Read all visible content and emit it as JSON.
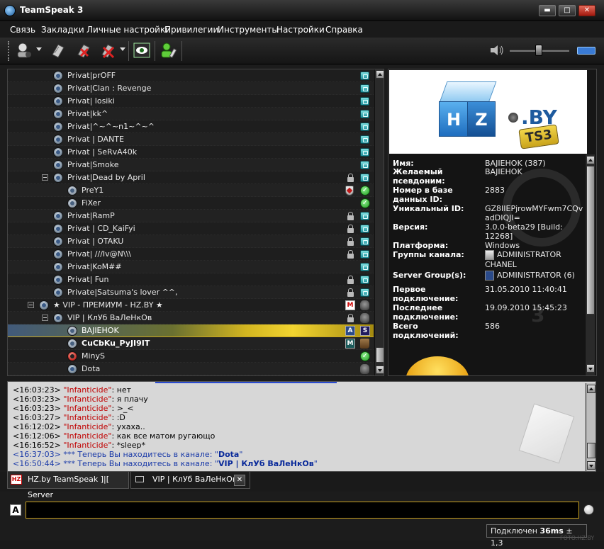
{
  "window": {
    "title": "TeamSpeak 3",
    "minimize": "▬",
    "maximize": "□",
    "close": "✕"
  },
  "menu": [
    "Связь",
    "Закладки",
    "Личные настройки",
    "Привилегии",
    "Инструменты",
    "Настройки",
    "Справка"
  ],
  "toolbar": {
    "icons": [
      "connect-icon",
      "bookmark-icon",
      "disconnect-icon",
      "disconnect-all-icon",
      "away-icon",
      "identity-icon"
    ],
    "volume_icon": "speaker-icon"
  },
  "tree": [
    {
      "label": "Privat|prOFF",
      "chat": true
    },
    {
      "label": "Privat|Clan : Revenge",
      "chat": true
    },
    {
      "label": "Privat| losiki",
      "chat": true
    },
    {
      "label": "Privat|kk^",
      "chat": true
    },
    {
      "label": "Privat|^~^~n1~^~^",
      "chat": true
    },
    {
      "label": "Privat | DANTE",
      "chat": true
    },
    {
      "label": "Privat | SeRvA40k",
      "chat": true
    },
    {
      "label": "Privat|Smoke",
      "chat": true
    },
    {
      "label": "Privat|Dead by April",
      "chat": true,
      "lock": true,
      "expander": true
    },
    {
      "label": "PreY1",
      "user": true,
      "shield": true,
      "ok": true
    },
    {
      "label": "FiXer",
      "user": true,
      "ok": true
    },
    {
      "label": "Privat|RamP",
      "chat": true,
      "lock": true,
      "dash": true
    },
    {
      "label": "Privat | CD_KaiFyi",
      "chat": true,
      "lock": true
    },
    {
      "label": "Privat | OTAKU",
      "chat": true,
      "lock": true
    },
    {
      "label": "Privat| ///Iv@N\\\\\\",
      "chat": true,
      "lock": true
    },
    {
      "label": "Privat|KoM##",
      "chat": true
    },
    {
      "label": "Privat| Fun",
      "chat": true,
      "lock": true
    },
    {
      "label": "Private|Satsuma's lover ^^,",
      "chat": true,
      "lock": true
    },
    {
      "label": "★ VIP - ПРЕМИУМ - HZ.BY ★",
      "lock": true,
      "m": true,
      "wolf": true,
      "expander": true,
      "level": 0
    },
    {
      "label": "VIP | КлУб ВаЛеНкОв",
      "lock": true,
      "dash": true,
      "wolf": true,
      "expander": true,
      "level": 1
    },
    {
      "label": "BAJIEHOK",
      "user": true,
      "selected": true,
      "shield": true,
      "a": true,
      "s": true
    },
    {
      "label": "CuCbKu_PyJI9IT",
      "user": true,
      "bold": true,
      "shield": true,
      "mbadge": true,
      "boot": true
    },
    {
      "label": "MinyS",
      "user": true,
      "red": true,
      "ok": true
    },
    {
      "label": "Dota",
      "wolf": true
    }
  ],
  "info": {
    "banner_cube_left": "H",
    "banner_cube_right": "Z",
    "banner_by": ".BY",
    "banner_ts3": "TS3",
    "watermark": "3",
    "fields": [
      {
        "k": "Имя:",
        "v": "BAJIEHOK (387)"
      },
      {
        "k": "Желаемый псевдоним:",
        "v": "BAJIEHOK"
      },
      {
        "k": "Номер в базе данных ID:",
        "v": "2883"
      },
      {
        "k": "Уникальный ID:",
        "v": "GZ8IIEPjrowMYFwm7CQvadDIQJI="
      },
      {
        "k": "Версия:",
        "v": "3.0.0-beta29 [Build: 12268]"
      },
      {
        "k": "Платформа:",
        "v": "Windows"
      },
      {
        "k": "Группы канала:",
        "v": "ADMINISTRATOR CHANEL"
      },
      {
        "k": "Server Group(s):",
        "v": "ADMINISTRATOR (6)"
      },
      {
        "k": "Первое подключение:",
        "v": "31.05.2010 11:40:41"
      },
      {
        "k": "Последнее подключение:",
        "v": "19.09.2010 15:45:23"
      },
      {
        "k": "Всего подключений:",
        "v": "586"
      }
    ]
  },
  "chat": [
    {
      "time": "<16:03:23>",
      "nick": "\"Infanticide\"",
      "text": ": нет"
    },
    {
      "time": "<16:03:23>",
      "nick": "\"Infanticide\"",
      "text": ": я плачу"
    },
    {
      "time": "<16:03:23>",
      "nick": "\"Infanticide\"",
      "text": ": >_<"
    },
    {
      "time": "<16:03:27>",
      "nick": "\"Infanticide\"",
      "text": ": :D"
    },
    {
      "time": "<16:12:02>",
      "nick": "\"Infanticide\"",
      "text": ": ухаха.."
    },
    {
      "time": "<16:12:06>",
      "nick": "\"Infanticide\"",
      "text": ": как все матом ругающо"
    },
    {
      "time": "<16:16:52>",
      "nick": "\"Infanticide\"",
      "text": ": *sleep*"
    }
  ],
  "chat_sys": [
    {
      "time": "<16:37:03>",
      "text": "*** Теперь Вы находитесь в канале: \"",
      "channel": "Dota",
      "end": "\""
    },
    {
      "time": "<16:50:44>",
      "text": "*** Теперь Вы находитесь в канале: \"",
      "channel": "VIP | КлУб ВаЛеНкОв",
      "end": "\""
    }
  ],
  "tabs": [
    {
      "label": "HZ.by TeamSpeak ]|[ Server",
      "icon": "HZ"
    },
    {
      "label": "VIP | КлУб ВаЛеНкОв",
      "close": "✕"
    }
  ],
  "input": {
    "value": "",
    "font_label": "A"
  },
  "status": {
    "prefix": "Подключен ",
    "ping": "36ms",
    "suffix": " ± 1,3"
  },
  "corner": "FOTO.HZ.BY"
}
